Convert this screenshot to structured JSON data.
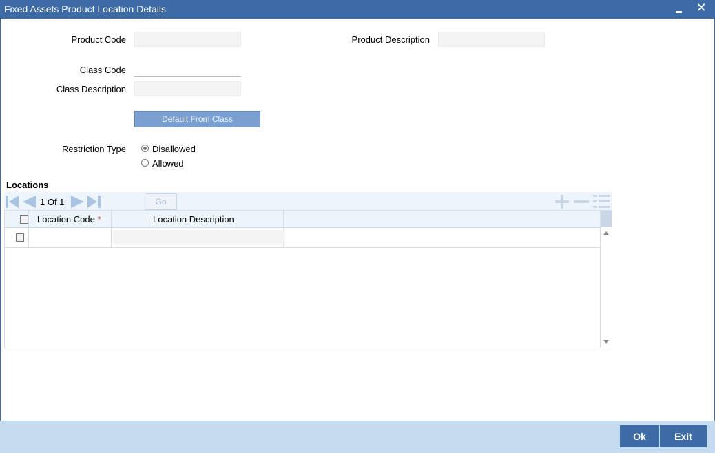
{
  "window": {
    "title": "Fixed Assets Product Location Details"
  },
  "form": {
    "product_code_label": "Product Code",
    "product_code_value": "",
    "product_description_label": "Product Description",
    "product_description_value": "",
    "class_code_label": "Class Code",
    "class_code_value": "",
    "class_description_label": "Class Description",
    "class_description_value": "",
    "default_button_label": "Default From Class",
    "restriction_type_label": "Restriction Type",
    "restriction_options": [
      {
        "label": "Disallowed",
        "selected": true
      },
      {
        "label": "Allowed",
        "selected": false
      }
    ]
  },
  "locations": {
    "section_title": "Locations",
    "pagination": {
      "text": "1 Of 1",
      "go_label": "Go",
      "go_value": ""
    },
    "columns": [
      {
        "label": "Location Code",
        "required_mark": "*"
      },
      {
        "label": "Location Description"
      }
    ],
    "rows": [
      {
        "location_code": "",
        "location_description": ""
      }
    ]
  },
  "footer": {
    "ok_label": "Ok",
    "exit_label": "Exit"
  },
  "colors": {
    "title_bar": "#3c6ba6",
    "footer_bg": "#c5dbef",
    "button_bg": "#3c6ba6",
    "default_button_bg": "#7aa0d2"
  }
}
